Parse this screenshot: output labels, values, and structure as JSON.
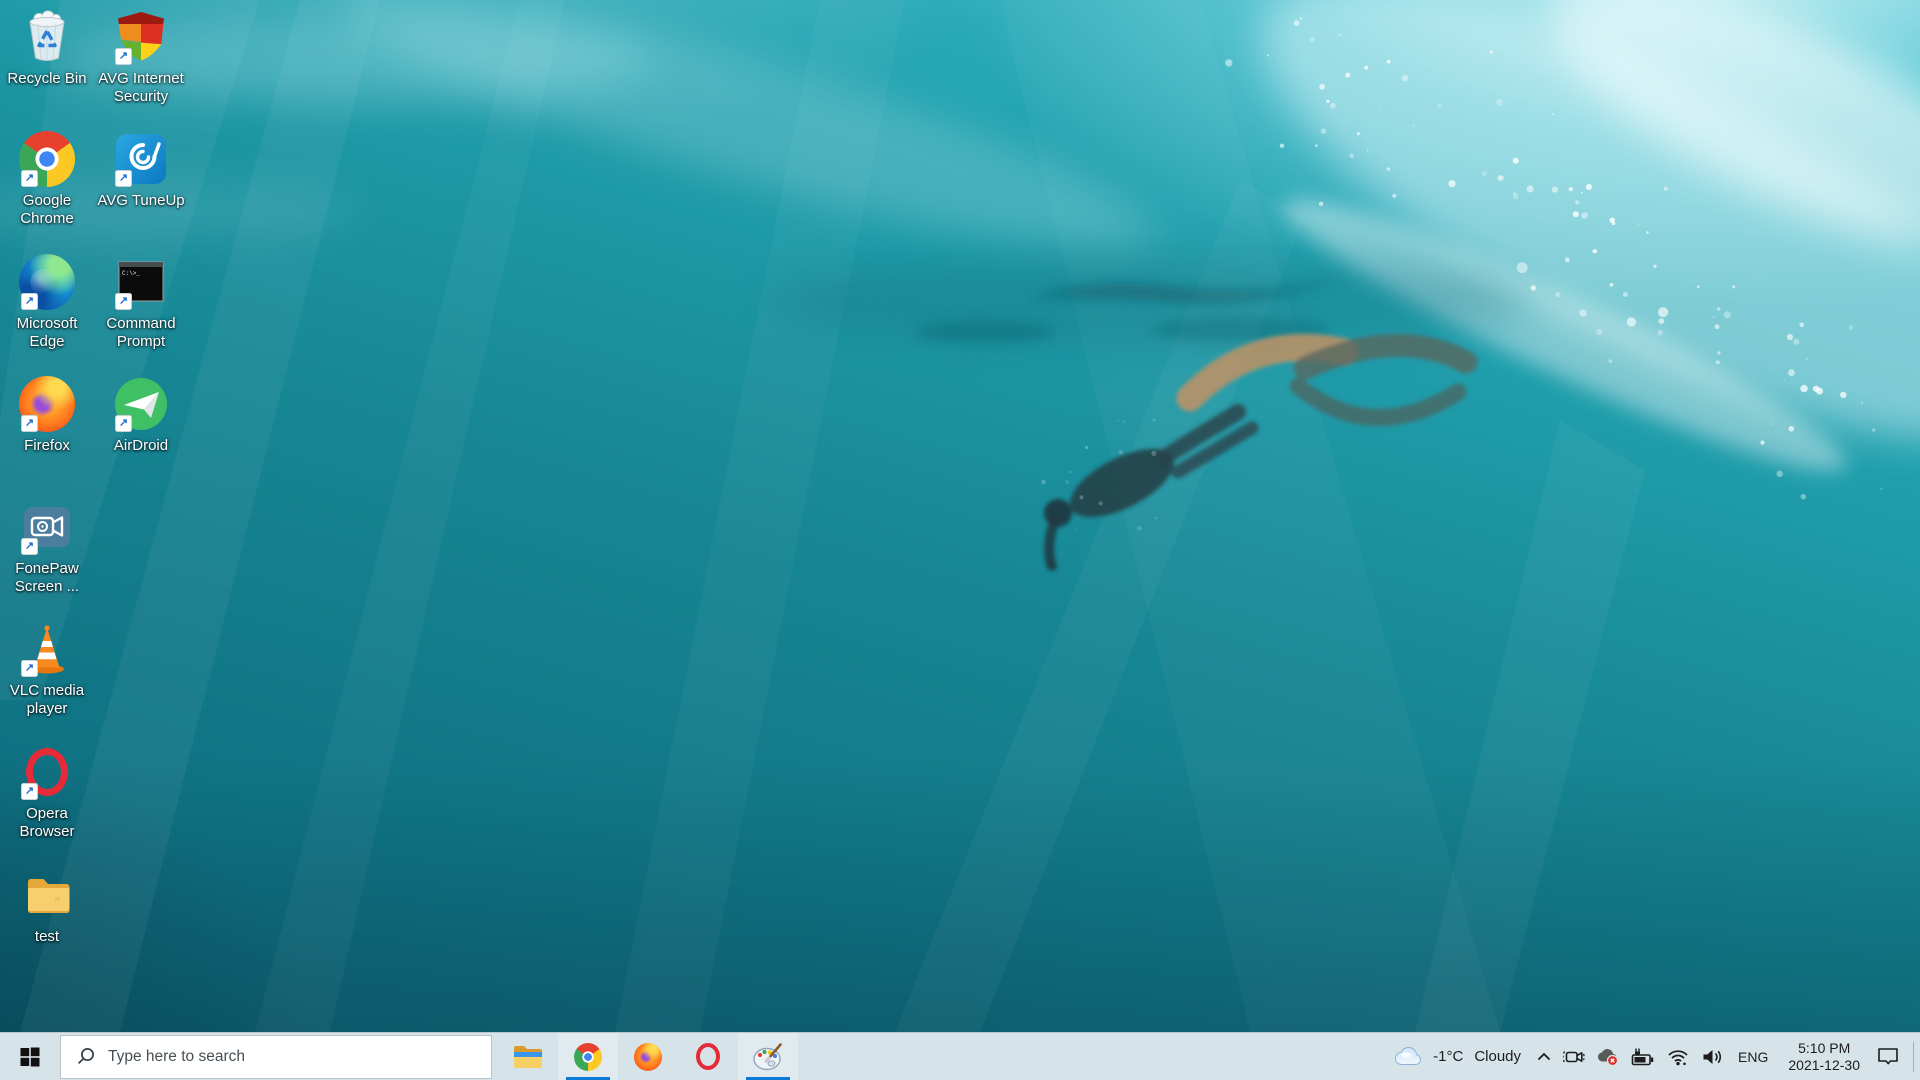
{
  "desktop": {
    "icons": [
      {
        "id": "recycle-bin",
        "label": "Recycle Bin",
        "lines": [
          "Recycle Bin"
        ],
        "shortcut": false
      },
      {
        "id": "avg-internet-security",
        "label": "AVG Internet Security",
        "lines": [
          "AVG Internet",
          "Security"
        ],
        "shortcut": true
      },
      {
        "id": "google-chrome",
        "label": "Google Chrome",
        "lines": [
          "Google",
          "Chrome"
        ],
        "shortcut": true
      },
      {
        "id": "avg-tuneup",
        "label": "AVG TuneUp",
        "lines": [
          "AVG TuneUp"
        ],
        "shortcut": true
      },
      {
        "id": "microsoft-edge",
        "label": "Microsoft Edge",
        "lines": [
          "Microsoft",
          "Edge"
        ],
        "shortcut": true
      },
      {
        "id": "command-prompt",
        "label": "Command Prompt",
        "lines": [
          "Command",
          "Prompt"
        ],
        "shortcut": true
      },
      {
        "id": "firefox",
        "label": "Firefox",
        "lines": [
          "Firefox"
        ],
        "shortcut": true
      },
      {
        "id": "airdroid",
        "label": "AirDroid",
        "lines": [
          "AirDroid"
        ],
        "shortcut": true
      },
      {
        "id": "fonepaw-screen-recorder",
        "label": "FonePaw Screen ...",
        "lines": [
          "FonePaw",
          "Screen ..."
        ],
        "shortcut": true
      },
      {
        "id": "vlc-media-player",
        "label": "VLC media player",
        "lines": [
          "VLC media",
          "player"
        ],
        "shortcut": true
      },
      {
        "id": "opera-browser",
        "label": "Opera Browser",
        "lines": [
          "Opera",
          "Browser"
        ],
        "shortcut": true
      },
      {
        "id": "test-folder",
        "label": "test",
        "lines": [
          "test"
        ],
        "shortcut": false
      }
    ]
  },
  "taskbar": {
    "start_icon": "windows-logo",
    "search_placeholder": "Type here to search",
    "apps": [
      {
        "name": "File Explorer",
        "icon": "file-explorer-icon",
        "active": false
      },
      {
        "name": "Google Chrome",
        "icon": "chrome-icon",
        "active": true
      },
      {
        "name": "Firefox",
        "icon": "firefox-icon",
        "active": false
      },
      {
        "name": "Opera",
        "icon": "opera-icon",
        "active": false
      },
      {
        "name": "Paint",
        "icon": "paint-icon",
        "active": true
      }
    ],
    "tray": {
      "temperature": "-1°C",
      "condition": "Cloudy",
      "icons": [
        "chevron-up",
        "meet-now-camera",
        "onedrive-offline",
        "battery-charging",
        "wifi",
        "volume"
      ],
      "language": "ENG",
      "time": "5:10 PM",
      "date": "2021-12-30"
    }
  },
  "colors": {
    "accent": "#0c7bd8",
    "taskbar_bg": "#d6e3e9",
    "water_top": "#38b8c7",
    "water_mid": "#178795",
    "water_bottom": "#0c6375"
  }
}
